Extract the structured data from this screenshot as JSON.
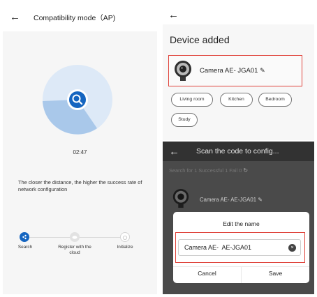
{
  "left_screen": {
    "title": "Compatibility mode（AP)",
    "timer": "02:47",
    "hint": "The closer the distance, the higher the success rate of network configuration",
    "progress_fraction": 0.5,
    "steps": [
      {
        "label": "Search",
        "state": "active"
      },
      {
        "label": "Register with the cloud",
        "state": "pending"
      },
      {
        "label": "Initialize",
        "state": "pending"
      }
    ],
    "colors": {
      "accent": "#1565c0",
      "pie_light": "#dde9f7",
      "pie_medium": "#a9c8ea"
    }
  },
  "device_added_screen": {
    "title": "Device added",
    "device_name": "Camera AE- JGA01",
    "edit_icon": "pencil-icon",
    "rooms": [
      "Living room",
      "Kitchen",
      "Bedroom",
      "Study"
    ]
  },
  "rename_screen": {
    "title": "Scan the code to config...",
    "status": "Search for 1  Successful 1  Fail 0",
    "device_name": "Camera AE-  AE-JGA01",
    "dialog": {
      "title": "Edit the name",
      "input_value": "Camera AE-  AE-JGA01",
      "cancel_label": "Cancel",
      "save_label": "Save"
    }
  },
  "icons": {
    "back": "←",
    "pencil": "✎",
    "clear": "×",
    "refresh": "↻"
  }
}
